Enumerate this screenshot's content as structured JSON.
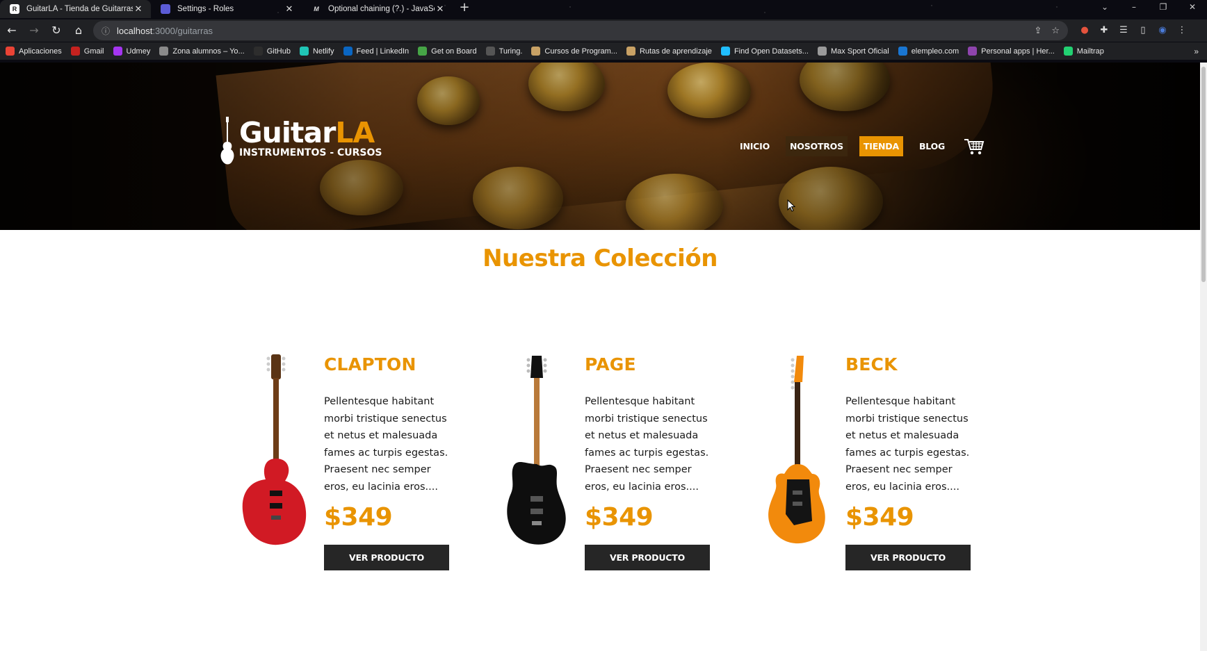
{
  "browser": {
    "tabs": [
      {
        "title": "GuitarLA - Tienda de Guitarras",
        "favicon": "R",
        "favicon_color": "#1c1c1c",
        "active": true
      },
      {
        "title": "Settings - Roles",
        "favicon": "",
        "favicon_color": "#5b5bd6",
        "active": false
      },
      {
        "title": "Optional chaining (?.) - JavaScript",
        "favicon": "M",
        "favicon_color": "#2b2b2b",
        "active": false
      }
    ],
    "url_host": "localhost",
    "url_path": ":3000/guitarras",
    "bookmarks": [
      {
        "label": "Aplicaciones",
        "color": "#ea4335"
      },
      {
        "label": "Gmail",
        "color": "#c5221f"
      },
      {
        "label": "Udmey",
        "color": "#a435f0"
      },
      {
        "label": "Zona alumnos – Yo...",
        "color": "#8a8a8a"
      },
      {
        "label": "GitHub",
        "color": "#2d2d2d"
      },
      {
        "label": "Netlify",
        "color": "#20c6b7"
      },
      {
        "label": "Feed | LinkedIn",
        "color": "#0a66c2"
      },
      {
        "label": "Get on Board",
        "color": "#46a546"
      },
      {
        "label": "Turing.",
        "color": "#555555"
      },
      {
        "label": "Cursos de Program...",
        "color": "#c8a165"
      },
      {
        "label": "Rutas de aprendizaje",
        "color": "#c8a165"
      },
      {
        "label": "Find Open Datasets...",
        "color": "#20beff"
      },
      {
        "label": "Max Sport Oficial",
        "color": "#9a9a9a"
      },
      {
        "label": "elempleo.com",
        "color": "#1976d2"
      },
      {
        "label": "Personal apps | Her...",
        "color": "#8e44ad"
      },
      {
        "label": "Mailtrap",
        "color": "#22d172"
      }
    ]
  },
  "header": {
    "logo": {
      "name_main": "Guitar",
      "name_accent": "LA",
      "tagline": "INSTRUMENTOS - CURSOS"
    },
    "nav": [
      {
        "label": "INICIO",
        "state": "normal"
      },
      {
        "label": "NOSOTROS",
        "state": "hover"
      },
      {
        "label": "TIENDA",
        "state": "active"
      },
      {
        "label": "BLOG",
        "state": "normal"
      }
    ],
    "cart_icon": "cart-icon"
  },
  "main": {
    "title": "Nuestra Colección",
    "products": [
      {
        "name": "CLAPTON",
        "description": "Pellentesque habitant morbi tristique senectus et netus et malesuada fames ac turpis egestas. Praesent nec semper eros, eu lacinia eros....",
        "price": "$349",
        "button": "VER PRODUCTO",
        "body_color": "#d11a24"
      },
      {
        "name": "PAGE",
        "description": "Pellentesque habitant morbi tristique senectus et netus et malesuada fames ac turpis egestas. Praesent nec semper eros, eu lacinia eros....",
        "price": "$349",
        "button": "VER PRODUCTO",
        "body_color": "#101010"
      },
      {
        "name": "BECK",
        "description": "Pellentesque habitant morbi tristique senectus et netus et malesuada fames ac turpis egestas. Praesent nec semper eros, eu lacinia eros....",
        "price": "$349",
        "button": "VER PRODUCTO",
        "body_color": "#f28a0c"
      }
    ]
  },
  "colors": {
    "accent": "#e99402",
    "button": "#262626"
  }
}
